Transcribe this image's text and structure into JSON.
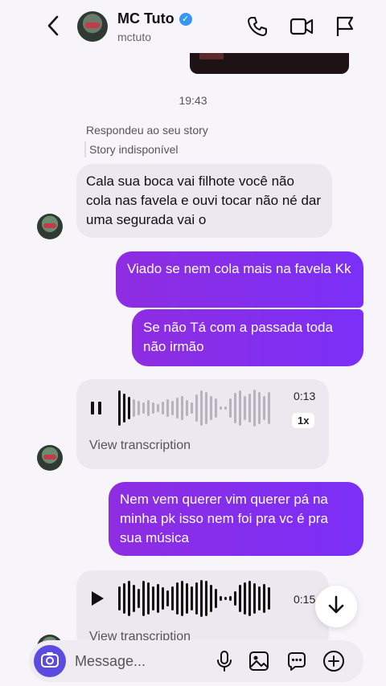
{
  "header": {
    "name": "MC Tuto",
    "username": "mctuto",
    "verified_badge": "✓"
  },
  "thread": {
    "timestamp": "19:43",
    "replied_label": "Respondeu ao seu story",
    "story_unavailable": "Story indisponível",
    "messages": [
      {
        "from": "them",
        "text": "Cala sua boca vai filhote você não cola nas favela e ouvi tocar não né dar uma segurada vai o"
      },
      {
        "from": "me",
        "text": "Viado se nem cola mais na favela Kk"
      },
      {
        "from": "me",
        "text": "Se não Tá com a passada toda não irmão"
      },
      {
        "from": "them",
        "type": "voice",
        "duration": "0:13",
        "speed": "1x",
        "transcription": "View transcription",
        "playing": true
      },
      {
        "from": "me",
        "text": "Nem vem querer vim querer pá na minha pk isso nem foi pra vc é pra sua música"
      },
      {
        "from": "them",
        "type": "voice",
        "duration": "0:15",
        "transcription": "View transcription",
        "playing": false
      }
    ]
  },
  "composer": {
    "placeholder": "Message..."
  },
  "colors": {
    "accent": "#7b2ff7",
    "bubble_in": "#ebe9ef",
    "camera_button": "#5b4bde",
    "verified": "#3797f0"
  },
  "icons": [
    "back-chevron-icon",
    "phone-icon",
    "video-icon",
    "flag-icon",
    "pause-icon",
    "play-icon",
    "arrow-down-icon",
    "camera-icon",
    "microphone-icon",
    "image-icon",
    "sticker-icon",
    "plus-icon"
  ]
}
